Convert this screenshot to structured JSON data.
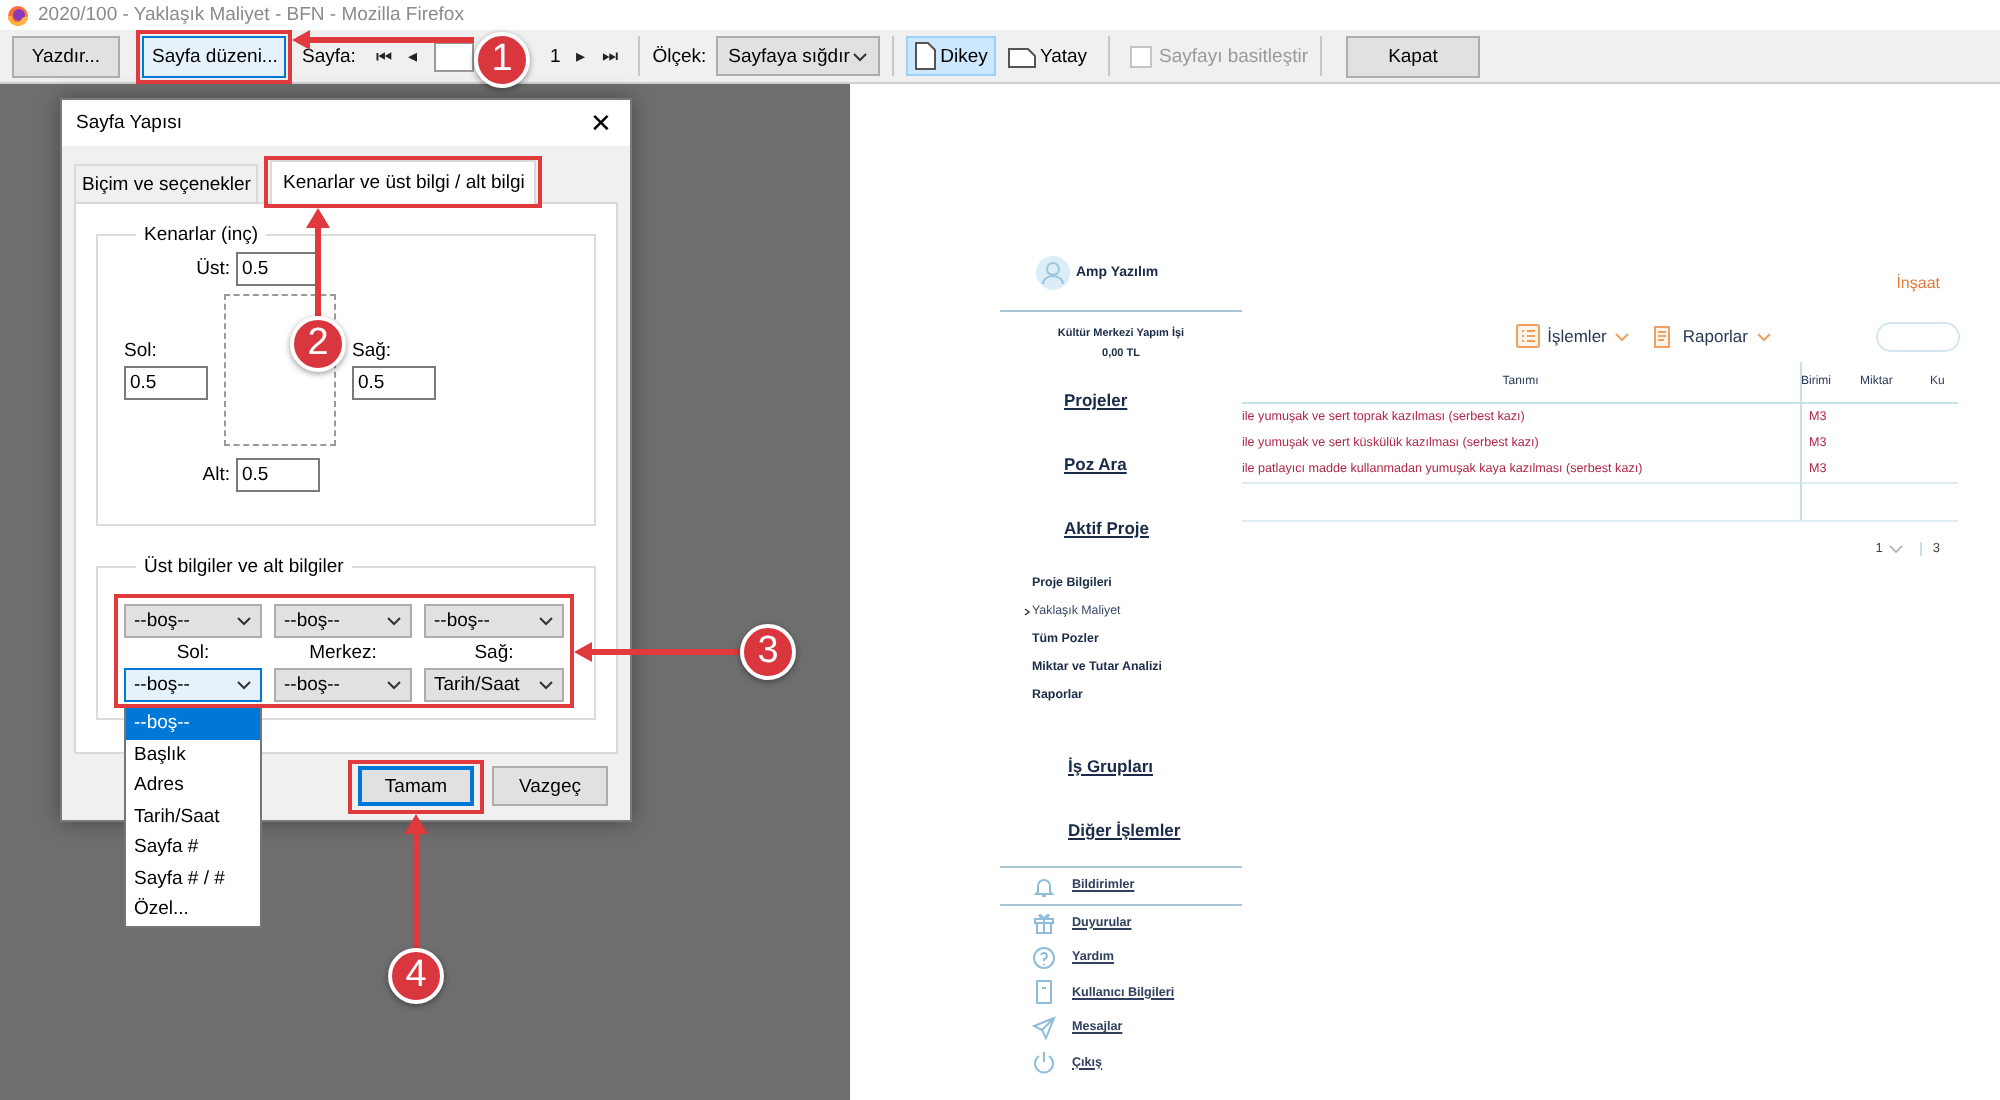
{
  "window": {
    "title": "2020/100 - Yaklaşık Maliyet - BFN - Mozilla Firefox"
  },
  "toolbar": {
    "print_button": "Yazdır...",
    "page_setup_button": "Sayfa düzeni...",
    "page_label": "Sayfa:",
    "first_button": "⏮",
    "prev_button": "◂",
    "page_count": "1",
    "next_button": "▸",
    "last_button": "⏭",
    "scale_label": "Ölçek:",
    "scale_select": "Sayfaya sığdır",
    "orientations": [
      {
        "label": "Dikey",
        "kind": "portrait",
        "selected": true
      },
      {
        "label": "Yatay",
        "kind": "landscape",
        "selected": false
      }
    ],
    "simplify": {
      "label": "Sayfayı basitleştir",
      "checked": false,
      "disabled": true
    },
    "close_button": "Kapat"
  },
  "dialog": {
    "title": "Sayfa Yapısı",
    "close": "✕",
    "tabs": [
      {
        "label": "Biçim ve seçenekler",
        "selected": false
      },
      {
        "label": "Kenarlar ve üst bilgi / alt bilgi",
        "selected": true
      }
    ],
    "margins": {
      "legend": "Kenarlar (inç)",
      "fields": [
        {
          "label": "Üst:",
          "value": "0.5"
        },
        {
          "label": "Sol:",
          "value": "0.5"
        },
        {
          "label": "Sağ:",
          "value": "0.5"
        },
        {
          "label": "Alt:",
          "value": "0.5"
        }
      ]
    },
    "headers_footers": {
      "legend": "Üst bilgiler ve alt bilgiler",
      "headers": [
        "--boş--",
        "--boş--",
        "--boş--"
      ],
      "positions": [
        "Sol:",
        "Merkez:",
        "Sağ:"
      ],
      "footers": [
        {
          "value": "--boş--",
          "focused": true
        },
        {
          "value": "--boş--",
          "focused": false
        },
        {
          "value": "Tarih/Saat",
          "focused": false
        }
      ]
    },
    "buttons": [
      {
        "label": "Tamam",
        "default": true
      },
      {
        "label": "Vazgeç",
        "default": false
      }
    ],
    "dropdown_options": [
      {
        "label": "--boş--",
        "selected": true
      },
      {
        "label": "Başlık",
        "selected": false
      },
      {
        "label": "Adres",
        "selected": false
      },
      {
        "label": "Tarih/Saat",
        "selected": false
      },
      {
        "label": "Sayfa #",
        "selected": false
      },
      {
        "label": "Sayfa # / #",
        "selected": false
      },
      {
        "label": "Özel...",
        "selected": false
      }
    ]
  },
  "callouts": [
    {
      "number": "1"
    },
    {
      "number": "2"
    },
    {
      "number": "3"
    },
    {
      "number": "4"
    }
  ],
  "preview": {
    "user": "Amp Yazılım",
    "sector": "İnşaat",
    "project": "Kültür Merkezi Yapım İşi",
    "amount": "0,00 TL",
    "main_nav": [
      "Projeler",
      "Poz Ara",
      "Aktif Proje"
    ],
    "project_nav": [
      {
        "label": "Proje Bilgileri",
        "selected": false
      },
      {
        "label": "Yaklaşık Maliyet",
        "selected": true
      },
      {
        "label": "Tüm Pozler",
        "selected": false
      },
      {
        "label": "Miktar ve Tutar Analizi",
        "selected": false
      },
      {
        "label": "Raporlar",
        "selected": false
      }
    ],
    "group_nav": [
      "İş Grupları",
      "Diğer İşlemler"
    ],
    "links": [
      {
        "label": "Bildirimler",
        "kind": "bell"
      },
      {
        "label": "Duyurular",
        "kind": "gift"
      },
      {
        "label": "Yardım",
        "kind": "help"
      },
      {
        "label": "Kullanıcı Bilgileri",
        "kind": "card"
      },
      {
        "label": "Mesajlar",
        "kind": "send"
      },
      {
        "label": "Çıkış",
        "kind": "power"
      }
    ],
    "menus": [
      {
        "label": "İşlemler",
        "kind": "list"
      },
      {
        "label": "Raporlar",
        "kind": "report"
      }
    ],
    "table": {
      "columns": [
        "Tanımı",
        "Birimi",
        "Miktar",
        "Ku"
      ],
      "rows": [
        [
          "ile yumuşak ve sert toprak kazılması (serbest kazı)",
          "M3"
        ],
        [
          "ile yumuşak ve sert küskülük kazılması (serbest kazı)",
          "M3"
        ],
        [
          "ile patlayıcı madde kullanmadan yumuşak kaya kazılması (serbest kazı)",
          "M3"
        ]
      ]
    },
    "pagination": {
      "page": "1",
      "total": "3"
    }
  }
}
